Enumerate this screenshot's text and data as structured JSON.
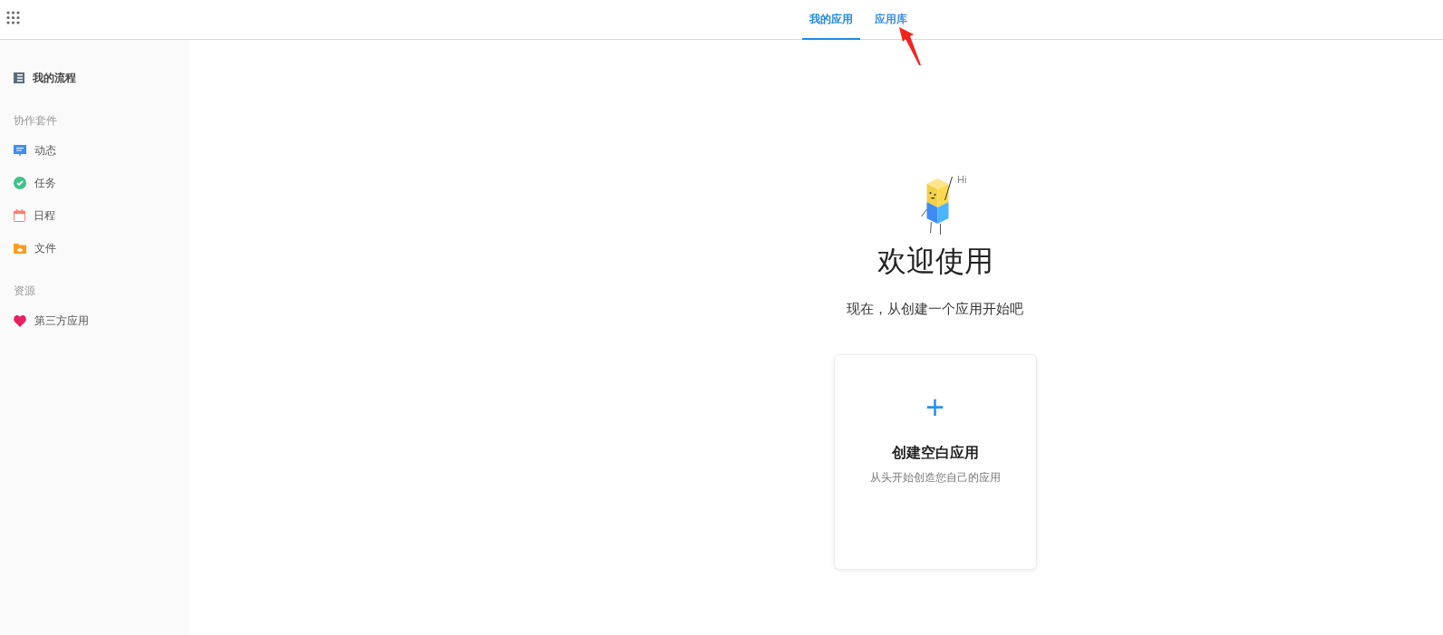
{
  "tabs": [
    {
      "label": "我的应用",
      "selected": true
    },
    {
      "label": "应用库",
      "selected": false
    }
  ],
  "sidebar": {
    "top_item": {
      "label": "我的流程"
    },
    "sections": [
      {
        "heading": "协作套件",
        "items": [
          {
            "label": "动态"
          },
          {
            "label": "任务"
          },
          {
            "label": "日程"
          },
          {
            "label": "文件"
          }
        ]
      },
      {
        "heading": "资源",
        "items": [
          {
            "label": "第三方应用"
          }
        ]
      }
    ]
  },
  "welcome": {
    "greeting": "Hi",
    "title": "欢迎使用",
    "subtitle": "现在，从创建一个应用开始吧"
  },
  "create_card": {
    "icon_text": "+",
    "title": "创建空白应用",
    "description": "从头开始创造您自己的应用"
  }
}
